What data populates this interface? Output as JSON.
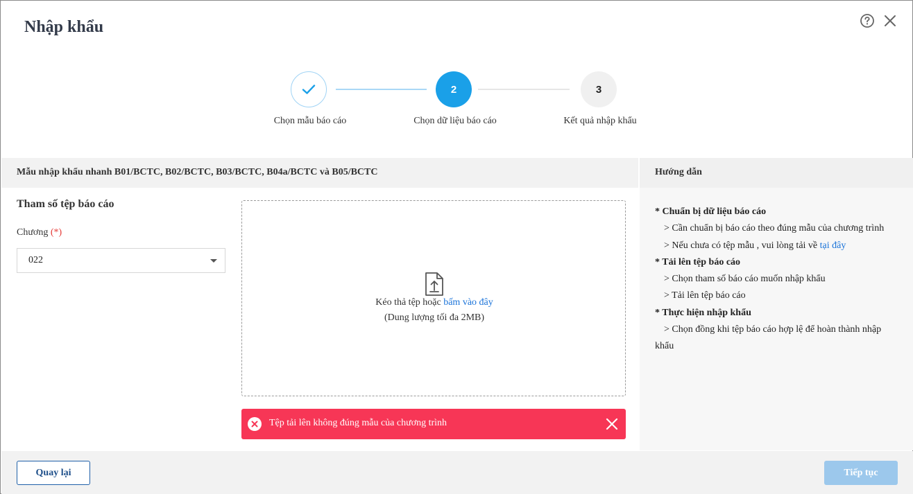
{
  "dialog": {
    "title": "Nhập khẩu"
  },
  "stepper": {
    "steps": [
      {
        "number": "1",
        "label": "Chọn mẫu báo cáo",
        "state": "completed"
      },
      {
        "number": "2",
        "label": "Chọn dữ liệu báo cáo",
        "state": "active"
      },
      {
        "number": "3",
        "label": "Kết quả nhập khẩu",
        "state": "pending"
      }
    ]
  },
  "template_header": "Mẫu nhập khẩu nhanh B01/BCTC, B02/BCTC, B03/BCTC, B04a/BCTC và B05/BCTC",
  "params": {
    "title": "Tham số tệp báo cáo",
    "chapter_label": "Chương",
    "required_mark": "(*)",
    "chapter_value": "022"
  },
  "dropzone": {
    "text_prefix": "Kéo thả tệp hoặc",
    "link_text": "bấm vào đây",
    "size_note": "(Dung lượng tối đa 2MB)"
  },
  "error": {
    "message": "Tệp tải lên không đúng mẫu của chương trình"
  },
  "guide": {
    "header": "Hướng dẫn",
    "sec1_title": "* Chuẩn bị dữ liệu báo cáo",
    "sec1_item1": "> Cần chuẩn bị báo cáo theo đúng mẫu của chương trình",
    "sec1_item2_prefix": "> Nếu chưa có tệp mẫu , vui lòng tải về",
    "sec1_item2_link": "tại đây",
    "sec2_title": "* Tải lên tệp báo cáo",
    "sec2_item1": "> Chọn tham số báo cáo muốn nhập khẩu",
    "sec2_item2": "> Tải lên tệp báo cáo",
    "sec3_title": "* Thực hiện nhập khẩu",
    "sec3_item1": "> Chọn đồng khi tệp báo cáo hợp lệ để hoàn thành nhập",
    "sec3_item1_cont": "khẩu"
  },
  "footer": {
    "back_label": "Quay lại",
    "next_label": "Tiếp tục"
  },
  "colors": {
    "primary": "#1aa0e8",
    "error": "#f73656",
    "link": "#1a73d9",
    "disabled_button": "#9cc8ec"
  }
}
